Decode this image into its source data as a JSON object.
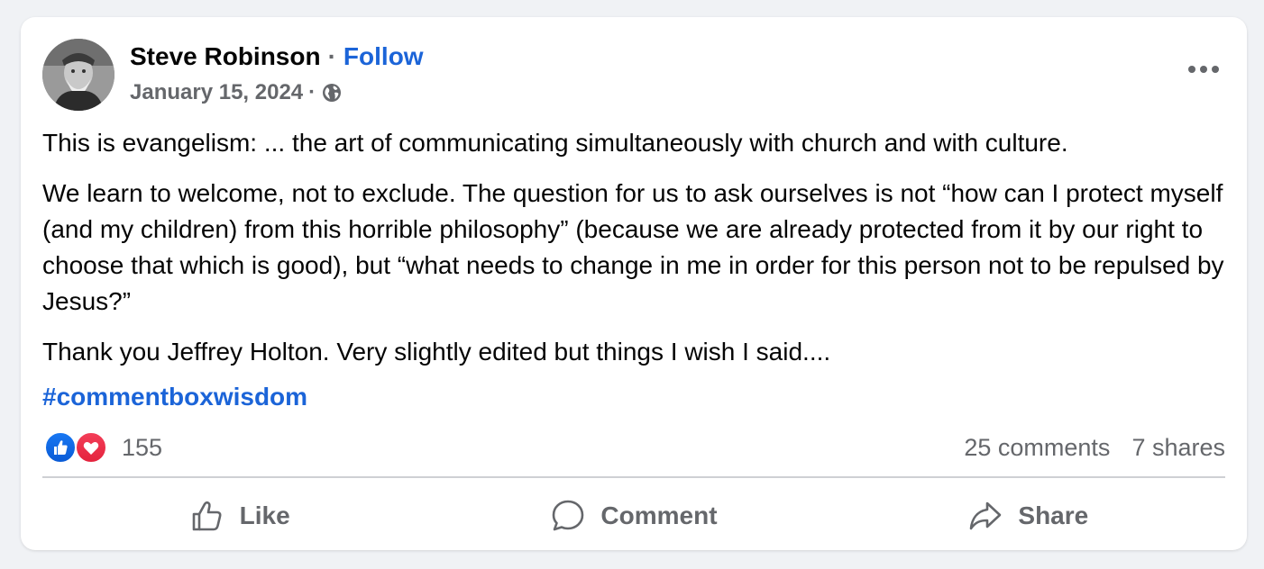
{
  "post": {
    "author": "Steve Robinson",
    "separator": "·",
    "follow_label": "Follow",
    "date": "January 15, 2024",
    "privacy_icon": "globe-icon",
    "more_icon": "more-options-icon",
    "paragraphs": [
      "This is evangelism: ... the art of communicating simultaneously with church and with culture.",
      "We learn to welcome, not to exclude. The question for us to ask ourselves is not “how can I protect myself (and my children) from this horrible philosophy” (because we are already protected from it by our right to choose that which is good), but “what needs to change in me in order for this person not to be repulsed by Jesus?”",
      "Thank you Jeffrey Holton. Very slightly edited but things I wish I said...."
    ],
    "hashtag": "#commentboxwisdom"
  },
  "stats": {
    "reactions_count": "155",
    "reaction_icons": [
      "like-reaction-icon",
      "love-reaction-icon"
    ],
    "comments": "25 comments",
    "shares": "7 shares"
  },
  "actions": {
    "like_label": "Like",
    "comment_label": "Comment",
    "share_label": "Share"
  },
  "colors": {
    "link": "#1b64d8",
    "secondary_text": "#65676b",
    "background": "#f0f2f5",
    "like_blue": "#1877f2",
    "love_red": "#f33e58"
  }
}
